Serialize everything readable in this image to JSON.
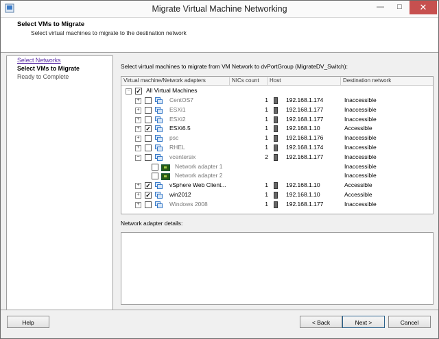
{
  "window": {
    "title": "Migrate Virtual Machine Networking"
  },
  "header": {
    "title": "Select VMs to Migrate",
    "subtitle": "Select virtual machines to migrate to the destination network"
  },
  "steps": [
    "Select Networks",
    "Select VMs to Migrate",
    "Ready to Complete"
  ],
  "main": {
    "instruction": "Select virtual machines to migrate from VM Network to dvPortGroup (MigrateDV_Switch):",
    "columns": [
      "Virtual machine/Network adapters",
      "NICs count",
      "Host",
      "Destination network"
    ],
    "root_label": "All Virtual Machines",
    "rows": [
      {
        "name": "CentOS7",
        "nics": "1",
        "host": "192.168.1.174",
        "dest": "Inaccessible",
        "checked": false,
        "accessible": false,
        "expand": "+"
      },
      {
        "name": "ESXi1",
        "nics": "1",
        "host": "192.168.1.177",
        "dest": "Inaccessible",
        "checked": false,
        "accessible": false,
        "expand": "+"
      },
      {
        "name": "ESXi2",
        "nics": "1",
        "host": "192.168.1.177",
        "dest": "Inaccessible",
        "checked": false,
        "accessible": false,
        "expand": "+"
      },
      {
        "name": "ESXi6.5",
        "nics": "1",
        "host": "192.168.1.10",
        "dest": "Accessible",
        "checked": true,
        "accessible": true,
        "expand": "+"
      },
      {
        "name": "psc",
        "nics": "1",
        "host": "192.168.1.176",
        "dest": "Inaccessible",
        "checked": false,
        "accessible": false,
        "expand": "+"
      },
      {
        "name": "RHEL",
        "nics": "1",
        "host": "192.168.1.174",
        "dest": "Inaccessible",
        "checked": false,
        "accessible": false,
        "expand": "+"
      },
      {
        "name": "vcentersix",
        "nics": "2",
        "host": "192.168.1.177",
        "dest": "Inaccessible",
        "checked": false,
        "accessible": false,
        "expand": "−"
      },
      {
        "name": "Network adapter 1",
        "dest": "Inaccessible",
        "adapter": true
      },
      {
        "name": "Network adapter 2",
        "dest": "Inaccessible",
        "adapter": true
      },
      {
        "name": "vSphere Web Client...",
        "nics": "1",
        "host": "192.168.1.10",
        "dest": "Accessible",
        "checked": true,
        "accessible": true,
        "expand": "+"
      },
      {
        "name": "win2012",
        "nics": "1",
        "host": "192.168.1.10",
        "dest": "Accessible",
        "checked": true,
        "accessible": true,
        "expand": "+"
      },
      {
        "name": "Windows 2008",
        "nics": "1",
        "host": "192.168.1.177",
        "dest": "Inaccessible",
        "checked": false,
        "accessible": false,
        "expand": "+"
      }
    ],
    "details_label": "Network adapter details:"
  },
  "buttons": {
    "help": "Help",
    "back": "< Back",
    "next": "Next >",
    "cancel": "Cancel"
  },
  "colors": {
    "close_button": "#c7504f",
    "visited_link": "#5a2ea6",
    "vm_icon": "#3a7bc8"
  }
}
